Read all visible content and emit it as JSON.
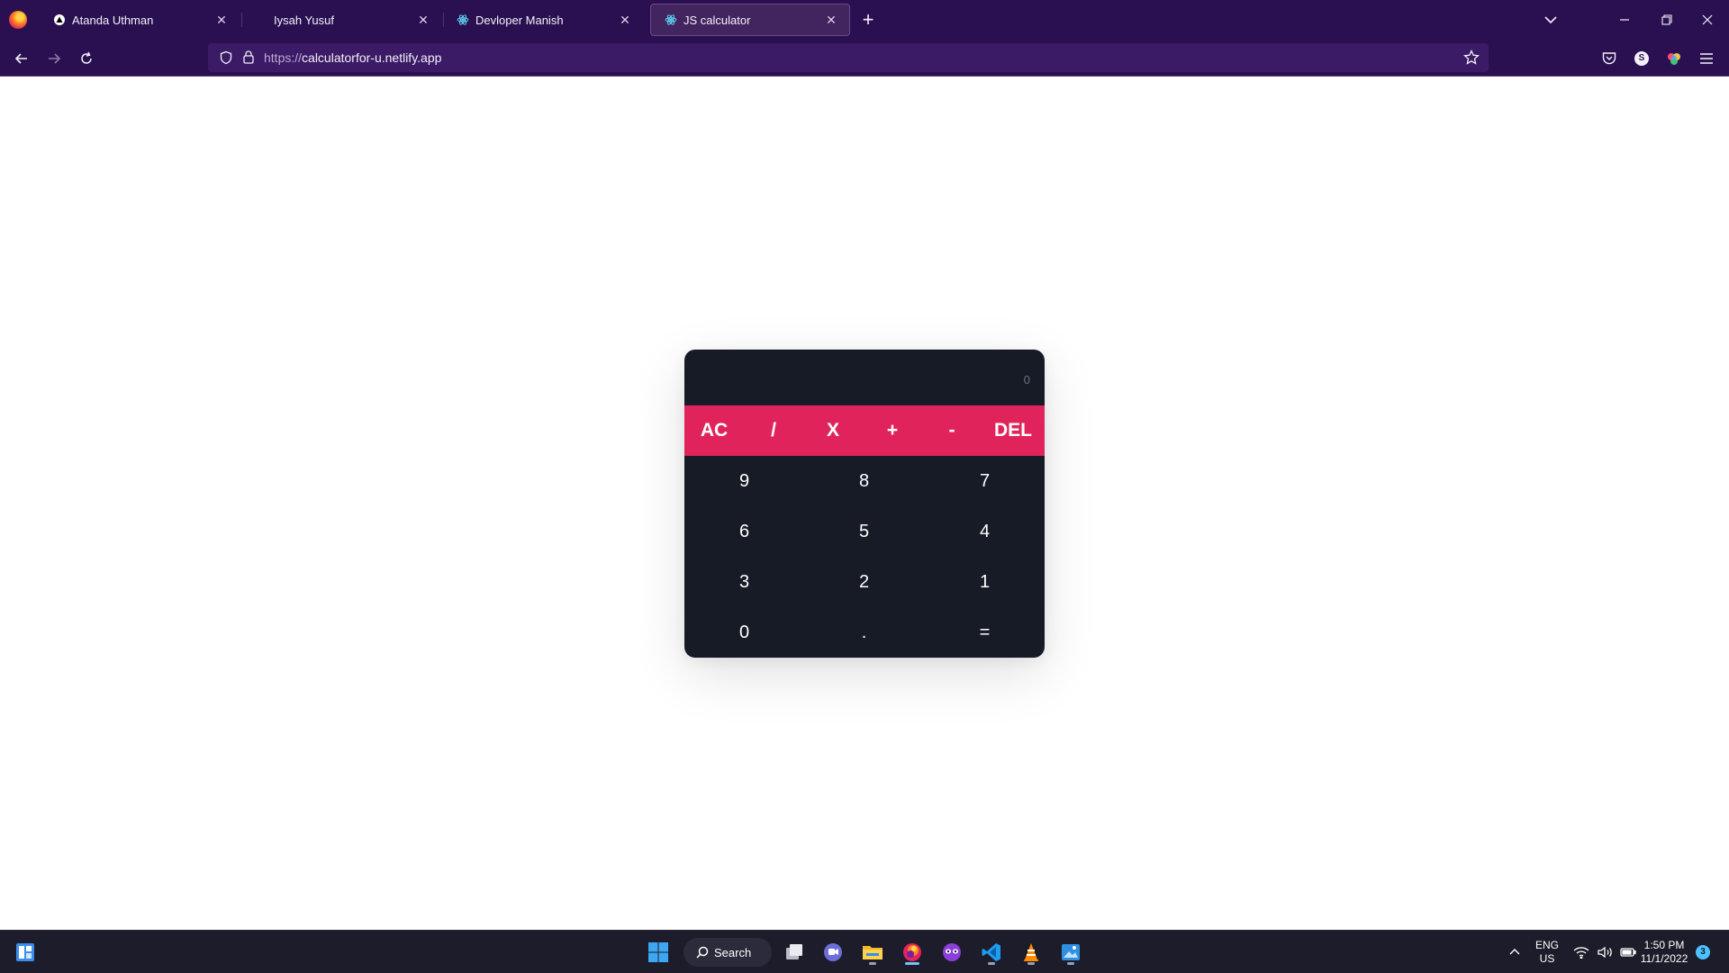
{
  "browser": {
    "tabs": [
      {
        "title": "Atanda Uthman",
        "icon": "vercel-triangle-icon",
        "active": false
      },
      {
        "title": "Iysah Yusuf",
        "icon": "",
        "active": false
      },
      {
        "title": "Devloper Manish",
        "icon": "react-icon",
        "active": false
      },
      {
        "title": "JS calculator",
        "icon": "react-icon",
        "active": true
      }
    ],
    "url_prefix": "https://",
    "url_host": "calculatorfor-u.netlify.app",
    "profile_initial": "S"
  },
  "calculator": {
    "display": "0",
    "operators": [
      "AC",
      "/",
      "X",
      "+",
      "-",
      "DEL"
    ],
    "keys": [
      [
        "9",
        "8",
        "7"
      ],
      [
        "6",
        "5",
        "4"
      ],
      [
        "3",
        "2",
        "1"
      ],
      [
        "0",
        ".",
        "="
      ]
    ],
    "accent_color": "#e0245b",
    "body_color": "#161b26"
  },
  "taskbar": {
    "search_label": "Search",
    "language": "ENG",
    "region": "US",
    "time": "1:50 PM",
    "date": "11/1/2022",
    "notification_count": "3"
  }
}
